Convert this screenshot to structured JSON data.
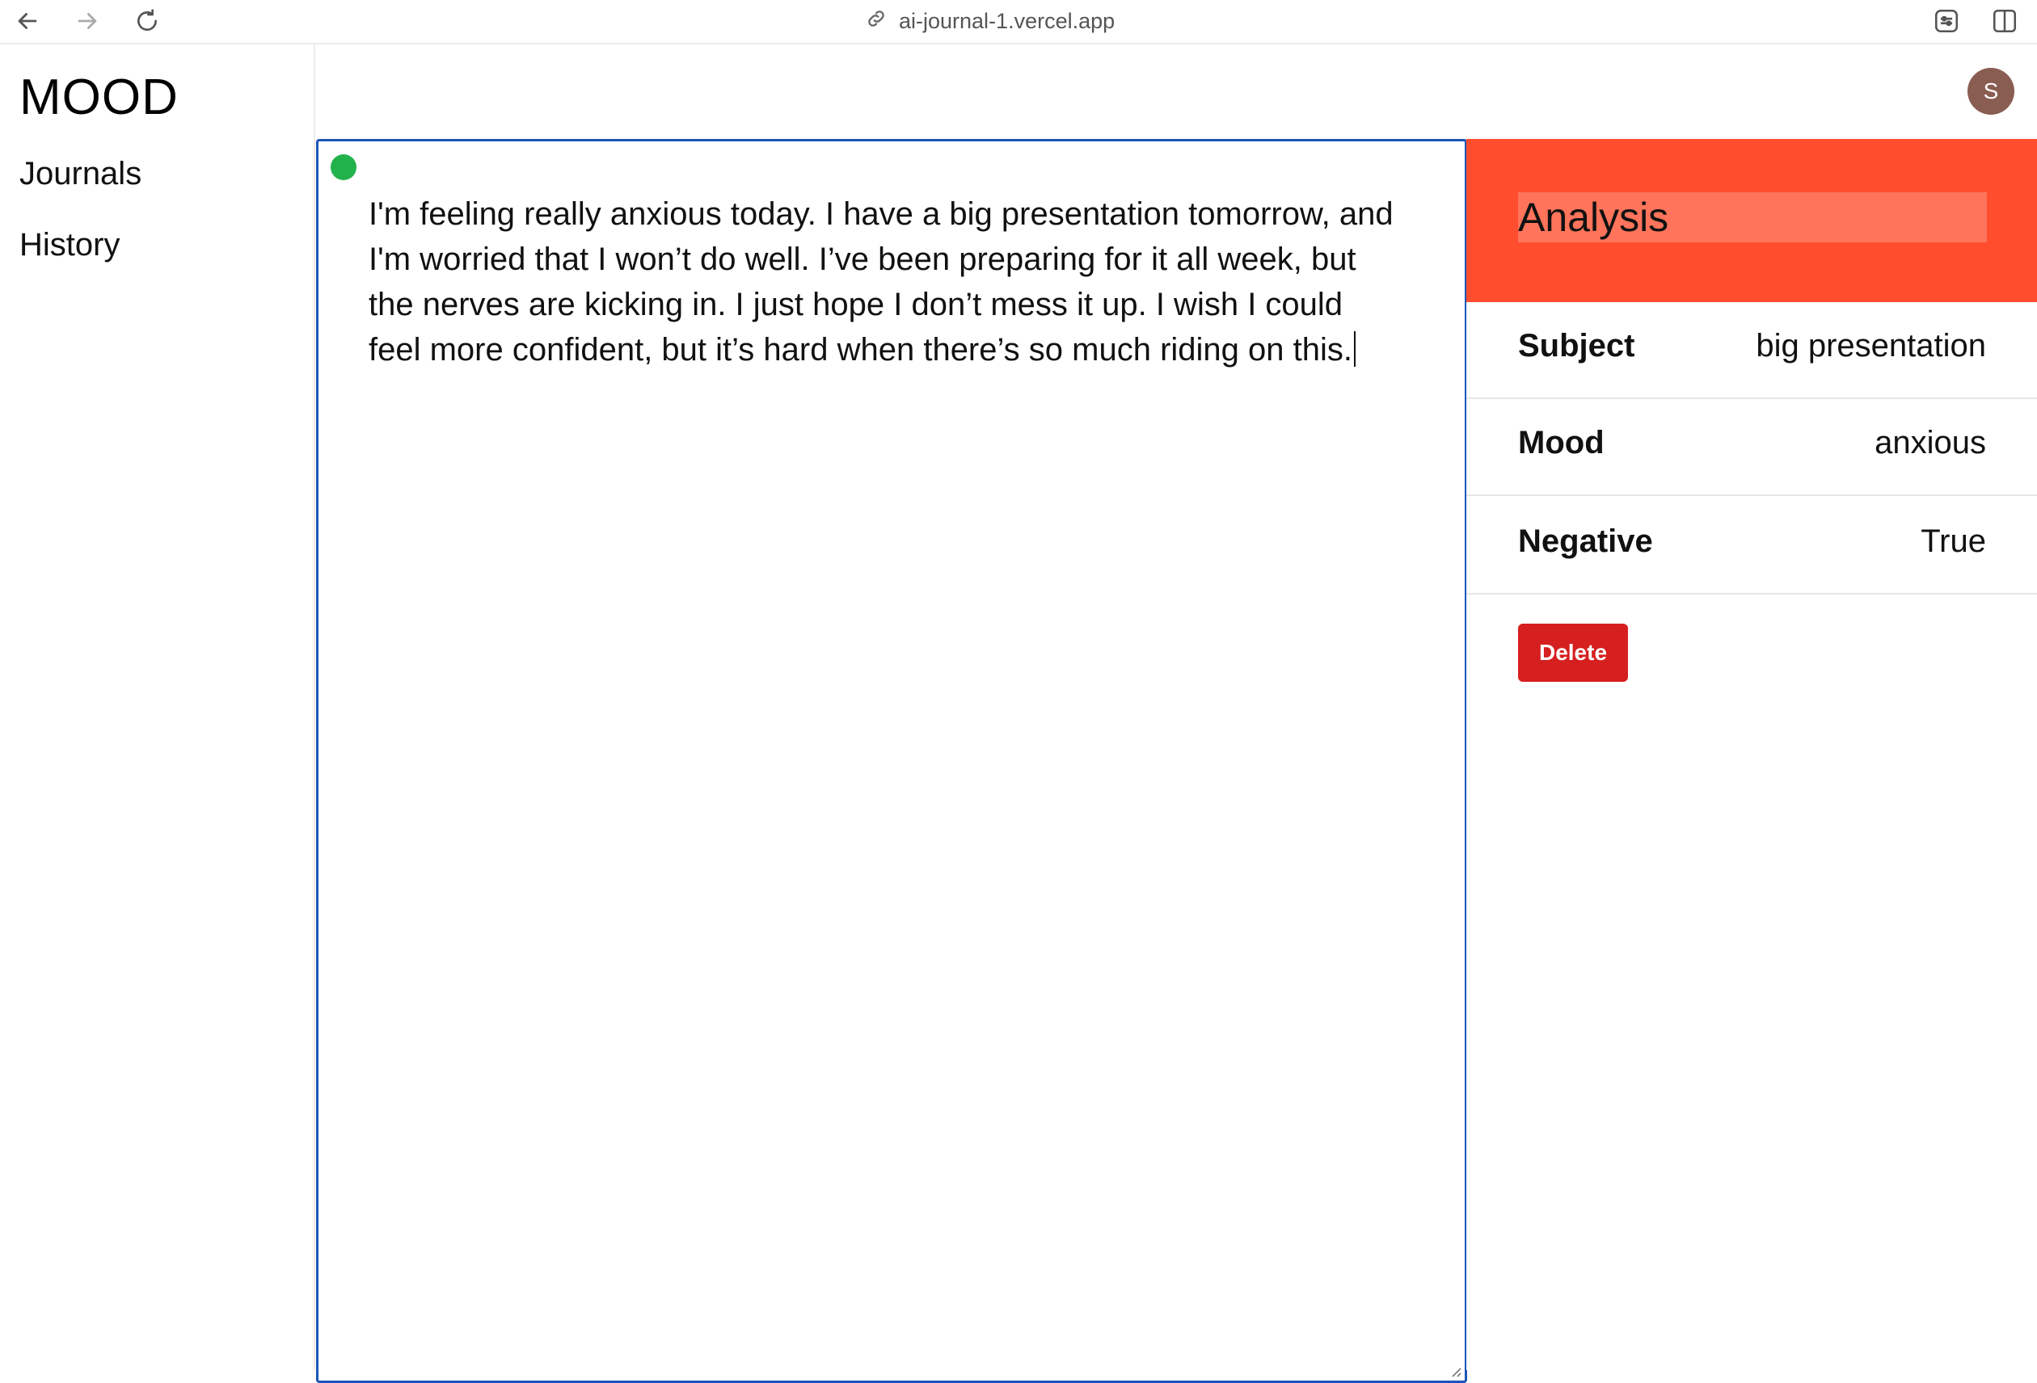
{
  "browser": {
    "url": "ai-journal-1.vercel.app",
    "icons": [
      "back-arrow-icon",
      "forward-arrow-icon",
      "reload-icon",
      "link-icon",
      "extension-icon",
      "sidebar-toggle-icon"
    ]
  },
  "sidebar": {
    "brand": "MOOD",
    "items": [
      {
        "label": "Journals"
      },
      {
        "label": "History"
      }
    ]
  },
  "header": {
    "avatar_initial": "S",
    "avatar_color": "#8a5d52"
  },
  "editor": {
    "content": "I'm feeling really anxious today. I have a big presentation tomorrow, and I'm worried that I won’t do well. I’ve been preparing for it all week, but the nerves are kicking in. I just hope I don’t mess it up. I wish I could feel more confident, but it’s hard when there’s so much riding on this.",
    "status_color": "#22b24c",
    "border_color": "#1a56b8"
  },
  "analysis": {
    "title": "Analysis",
    "header_color": "#ff4d2e",
    "rows": [
      {
        "key": "Subject",
        "value": "big presentation"
      },
      {
        "key": "Mood",
        "value": "anxious"
      },
      {
        "key": "Negative",
        "value": "True"
      }
    ],
    "delete_label": "Delete",
    "delete_color": "#d61f1f"
  }
}
